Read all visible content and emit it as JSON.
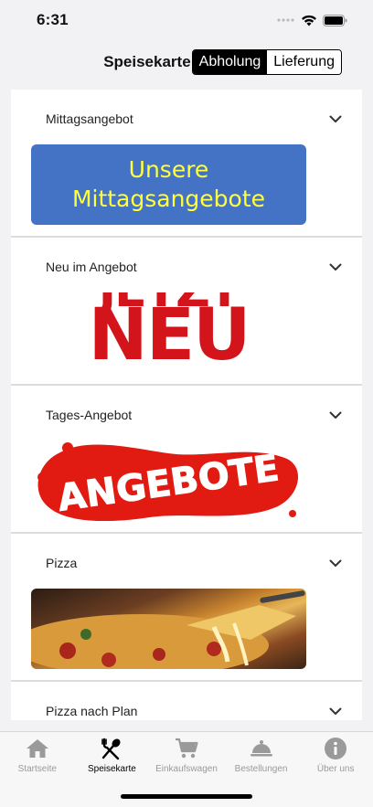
{
  "status_bar": {
    "time": "6:31"
  },
  "header": {
    "title": "Speisekarte",
    "segments": [
      {
        "label": "Abholung",
        "selected": true
      },
      {
        "label": "Lieferung",
        "selected": false
      }
    ]
  },
  "categories": [
    {
      "name": "Mittagsangebot",
      "banner_text_1": "Unsere",
      "banner_text_2": "Mittagsangebote"
    },
    {
      "name": "Neu im Angebot",
      "banner_text_top": "JETZT",
      "banner_text": "NEU"
    },
    {
      "name": "Tages-Angebot",
      "banner_text": "ANGEBOTE"
    },
    {
      "name": "Pizza"
    },
    {
      "name": "Pizza nach Plan"
    }
  ],
  "tabs": [
    {
      "label": "Startseite",
      "icon": "home-icon",
      "active": false
    },
    {
      "label": "Speisekarte",
      "icon": "cutlery-icon",
      "active": true
    },
    {
      "label": "Einkaufswagen",
      "icon": "cart-icon",
      "active": false
    },
    {
      "label": "Bestellungen",
      "icon": "cloche-icon",
      "active": false
    },
    {
      "label": "Über uns",
      "icon": "info-icon",
      "active": false
    }
  ],
  "colors": {
    "accent": "#000000",
    "inactive": "#9a9a9a",
    "banner_blue": "#4472c4",
    "banner_yellow": "#ffff3b",
    "banner_red": "#d3151b"
  }
}
